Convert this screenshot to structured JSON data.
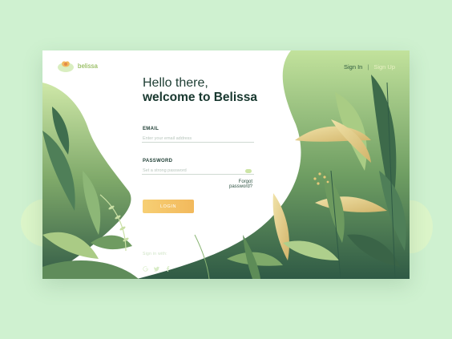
{
  "brand": {
    "name": "belissa",
    "icon": "flower-logo-icon"
  },
  "header": {
    "sign_in": "Sign In",
    "separator": "|",
    "sign_up": "Sign Up"
  },
  "hero": {
    "line1": "Hello there,",
    "line2": "welcome to Belissa"
  },
  "form": {
    "email_label": "EMAIL",
    "email_placeholder": "Enter your email address",
    "password_label": "PASSWORD",
    "password_placeholder": "Set a strong password",
    "forgot": "Forgot password?",
    "login": "LOGIN"
  },
  "social": {
    "label": "Sign in with:",
    "icons": [
      "google-icon",
      "twitter-icon",
      "facebook-icon"
    ]
  },
  "colors": {
    "background": "#cff1d0",
    "card": "#ffffff",
    "foliage_dark": "#3f6e4e",
    "foliage_light": "#b8d98c",
    "accent": "#f2b95c",
    "heading": "#17372e"
  }
}
